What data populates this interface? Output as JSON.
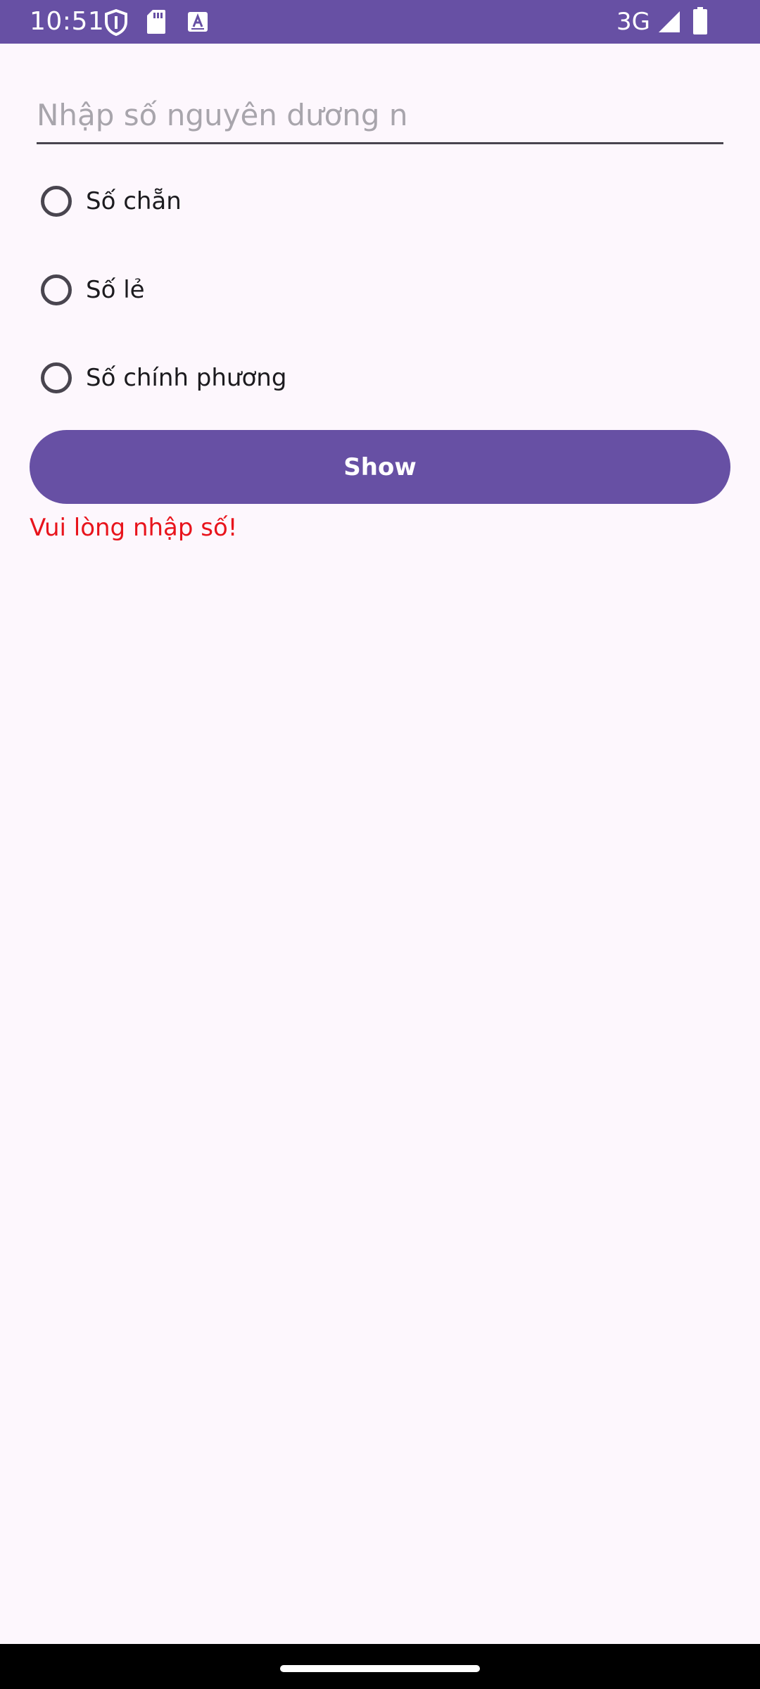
{
  "status_bar": {
    "time": "10:51",
    "network": "3G",
    "icons": [
      "shield-icon",
      "sd-card-icon",
      "keyboard-a-icon",
      "signal-icon",
      "battery-icon"
    ],
    "background_color": "#6750A4"
  },
  "form": {
    "input": {
      "placeholder": "Nhập số nguyên dương n",
      "value": ""
    },
    "options": [
      {
        "label": "Số chẵn",
        "selected": false
      },
      {
        "label": "Số lẻ",
        "selected": false
      },
      {
        "label": "Số chính phương",
        "selected": false
      }
    ],
    "show_button_label": "Show",
    "error_message": "Vui lòng nhập số!"
  },
  "colors": {
    "accent": "#6750A4",
    "error": "#E8141C",
    "background": "#FDF7FD"
  }
}
